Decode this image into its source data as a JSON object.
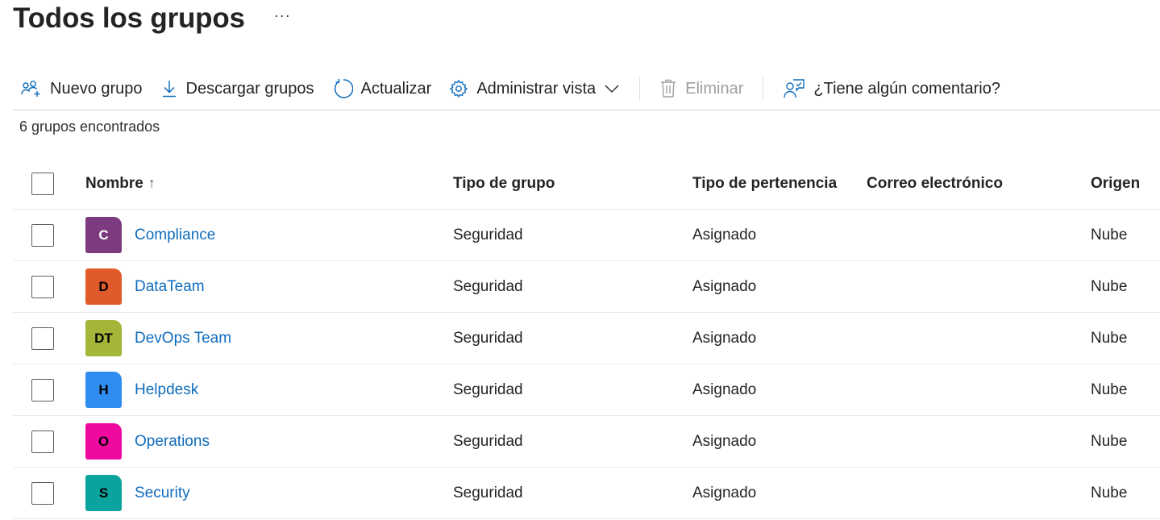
{
  "header": {
    "title": "Todos los grupos",
    "more_label": "···"
  },
  "toolbar": {
    "new_group": {
      "label": "Nuevo grupo",
      "icon": "people-add-icon"
    },
    "download": {
      "label": "Descargar grupos",
      "icon": "download-icon"
    },
    "refresh": {
      "label": "Actualizar",
      "icon": "refresh-icon"
    },
    "manage_view": {
      "label": "Administrar vista",
      "icon": "gear-icon"
    },
    "delete": {
      "label": "Eliminar",
      "icon": "trash-icon",
      "disabled": true
    },
    "feedback": {
      "label": "¿Tiene algún comentario?",
      "icon": "feedback-icon"
    }
  },
  "result_count": "6 grupos encontrados",
  "table": {
    "columns": {
      "name": "Nombre",
      "sort_indicator": "↑",
      "type": "Tipo de grupo",
      "membership": "Tipo de pertenencia",
      "mail": "Correo electrónico",
      "origin": "Origen"
    },
    "rows": [
      {
        "initials": "C",
        "avatar_color": "#7b3b7e",
        "avatar_text_color": "#ffffff",
        "name": "Compliance",
        "type": "Seguridad",
        "membership": "Asignado",
        "mail": "",
        "origin": "Nube"
      },
      {
        "initials": "D",
        "avatar_color": "#e05a2c",
        "avatar_text_color": "#000000",
        "name": "DataTeam",
        "type": "Seguridad",
        "membership": "Asignado",
        "mail": "",
        "origin": "Nube"
      },
      {
        "initials": "DT",
        "avatar_color": "#a4b537",
        "avatar_text_color": "#000000",
        "name": "DevOps Team",
        "type": "Seguridad",
        "membership": "Asignado",
        "mail": "",
        "origin": "Nube"
      },
      {
        "initials": "H",
        "avatar_color": "#2f8cf0",
        "avatar_text_color": "#000000",
        "name": "Helpdesk",
        "type": "Seguridad",
        "membership": "Asignado",
        "mail": "",
        "origin": "Nube"
      },
      {
        "initials": "O",
        "avatar_color": "#f0099f",
        "avatar_text_color": "#000000",
        "name": "Operations",
        "type": "Seguridad",
        "membership": "Asignado",
        "mail": "",
        "origin": "Nube"
      },
      {
        "initials": "S",
        "avatar_color": "#0aa39e",
        "avatar_text_color": "#000000",
        "name": "Security",
        "type": "Seguridad",
        "membership": "Asignado",
        "mail": "",
        "origin": "Nube"
      }
    ]
  },
  "colors": {
    "link": "#0f6cbd",
    "accent": "#0f6cbd",
    "disabled": "#a19f9d"
  }
}
